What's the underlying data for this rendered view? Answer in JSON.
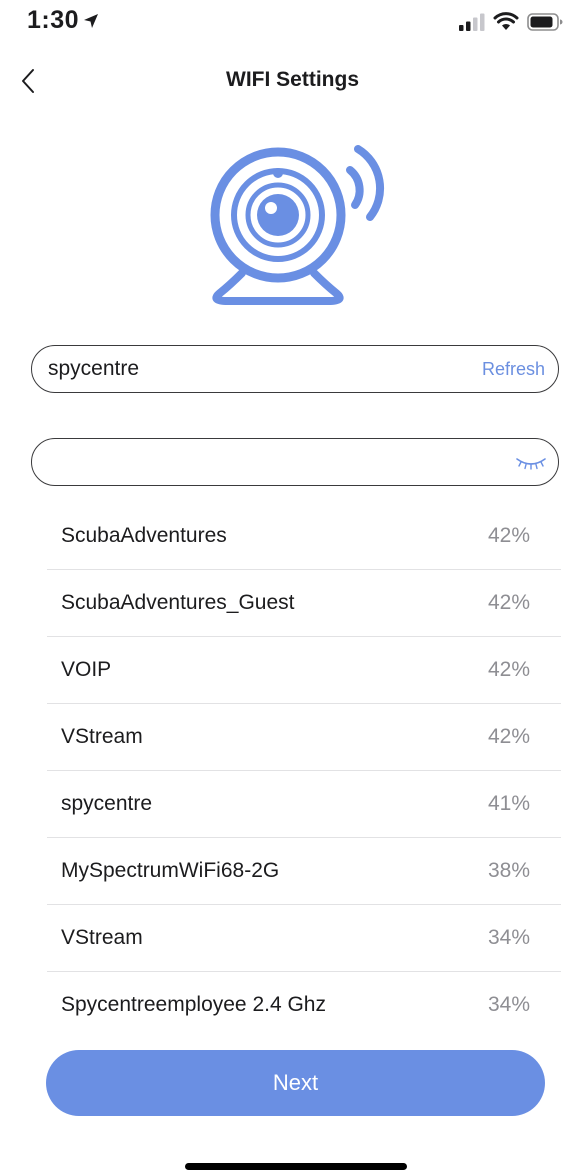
{
  "status_bar": {
    "time": "1:30",
    "icons": [
      "location-arrow-icon",
      "cellular-signal-icon",
      "wifi-icon",
      "battery-icon"
    ]
  },
  "header": {
    "back_icon": "chevron-left-icon",
    "title": "WIFI Settings"
  },
  "hero": {
    "icon": "wifi-camera-icon",
    "color": "#6a8fe3"
  },
  "ssid_field": {
    "value": "spycentre",
    "refresh_label": "Refresh"
  },
  "password_field": {
    "value": "",
    "toggle_icon": "eye-closed-icon"
  },
  "networks": [
    {
      "name": "ScubaAdventures",
      "strength": "42%"
    },
    {
      "name": "ScubaAdventures_Guest",
      "strength": "42%"
    },
    {
      "name": "VOIP",
      "strength": "42%"
    },
    {
      "name": "VStream",
      "strength": "42%"
    },
    {
      "name": "spycentre",
      "strength": "41%"
    },
    {
      "name": "MySpectrumWiFi68-2G",
      "strength": "38%"
    },
    {
      "name": "VStream",
      "strength": "34%"
    },
    {
      "name": "Spycentreemployee 2.4 Ghz",
      "strength": "34%"
    }
  ],
  "next_button": {
    "label": "Next",
    "color": "#6a8fe3"
  },
  "colors": {
    "accent": "#6a8fe3",
    "link": "#6b8fe0",
    "secondary_text": "#8e8e93"
  }
}
